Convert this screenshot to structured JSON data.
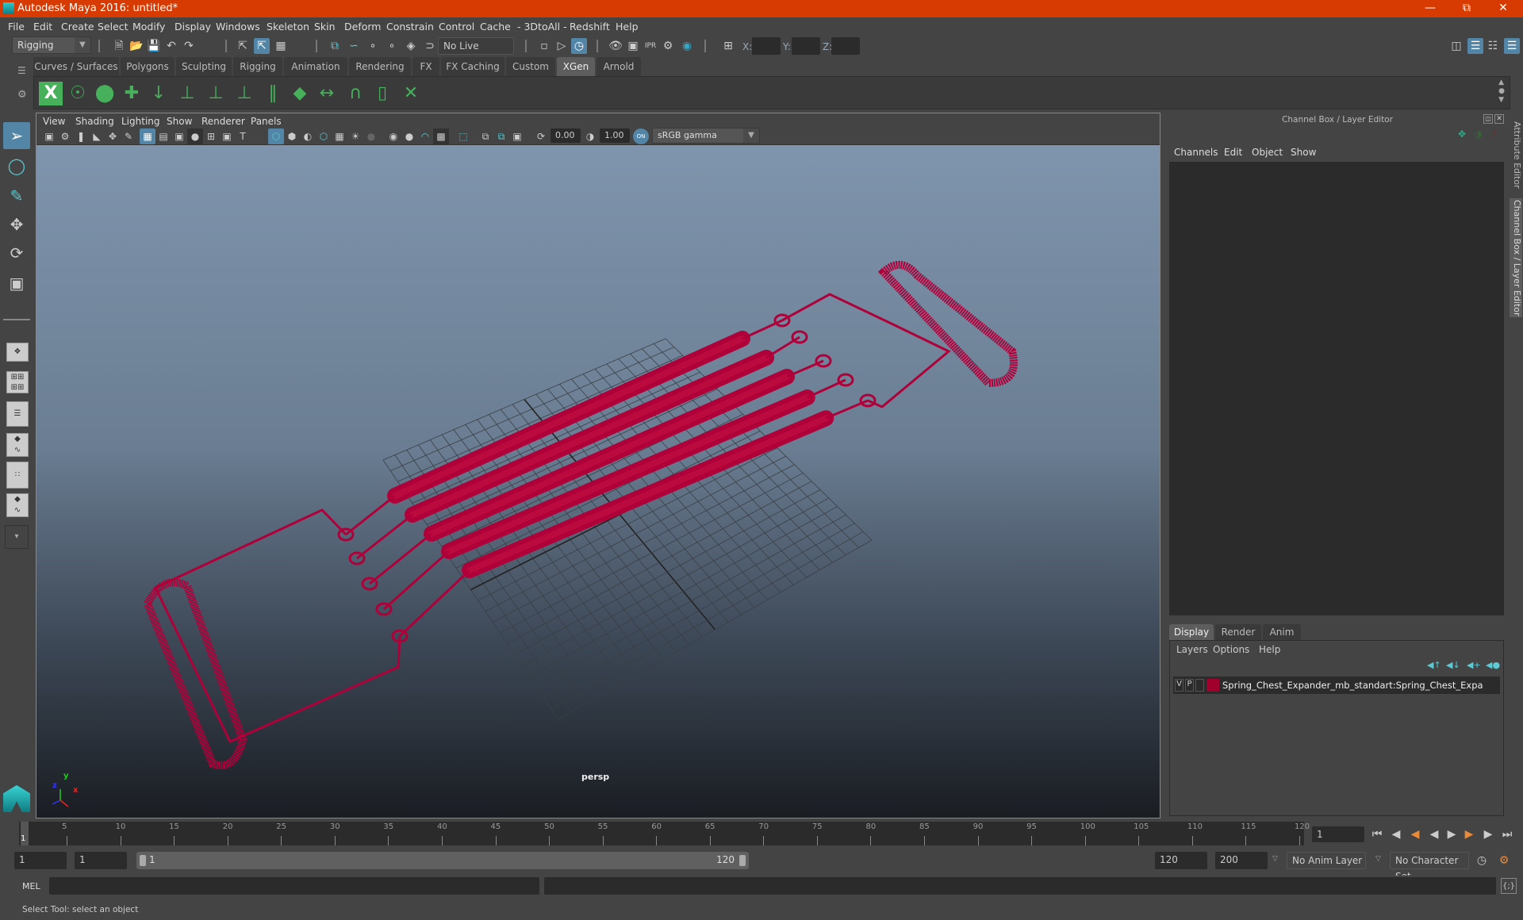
{
  "window": {
    "title": "Autodesk Maya 2016: untitled*",
    "controls": [
      "minimize",
      "restore",
      "close"
    ]
  },
  "menubar": [
    "File",
    "Edit",
    "Create",
    "Select",
    "Modify",
    "Display",
    "Windows",
    "Skeleton",
    "Skin",
    "Deform",
    "Constrain",
    "Control",
    "Cache",
    "- 3DtoAll -",
    "Redshift",
    "Help"
  ],
  "statusline": {
    "menuset": "Rigging",
    "live_surface": "No Live Surface",
    "x_label": "X:",
    "y_label": "Y:",
    "z_label": "Z:",
    "x_value": "",
    "y_value": "",
    "z_value": ""
  },
  "shelf": {
    "tabs": [
      "Curves / Surfaces",
      "Polygons",
      "Sculpting",
      "Rigging",
      "Animation",
      "Rendering",
      "FX",
      "FX Caching",
      "Custom",
      "XGen",
      "Arnold"
    ],
    "active_tab": "XGen",
    "icons": [
      "xgen-editor-icon",
      "xgen-preview-icon",
      "xgen-clear-preview-icon",
      "add-guide-icon",
      "sculpt-guide-icon",
      "add-guide-tool-icon",
      "guide-visibility-icon",
      "lock-guide-icon",
      "guide-split-icon",
      "density-map-icon",
      "bind-guide-icon",
      "select-guide-icon",
      "guide-bounds-icon",
      "delete-guide-icon"
    ]
  },
  "toolbox": [
    "select-tool",
    "lasso-tool",
    "paint-select-tool",
    "move-tool",
    "rotate-tool",
    "scale-tool"
  ],
  "viewport": {
    "menu": [
      "View",
      "Shading",
      "Lighting",
      "Show",
      "Renderer",
      "Panels"
    ],
    "exposure": "0.00",
    "gamma": "1.00",
    "color_mgmt": "ON",
    "color_space": "sRGB gamma",
    "camera_label": "persp",
    "axis": {
      "x": "x",
      "y": "y",
      "z": "z"
    },
    "wire_color": "#b0003a"
  },
  "channel_box": {
    "title": "Channel Box / Layer Editor",
    "menu": [
      "Channels",
      "Edit",
      "Object",
      "Show"
    ]
  },
  "layer_editor": {
    "tabs": [
      "Display",
      "Render",
      "Anim"
    ],
    "active_tab": "Display",
    "menu": [
      "Layers",
      "Options",
      "Help"
    ],
    "layers": [
      {
        "v": "V",
        "p": "P",
        "color": "#a0002c",
        "name": "Spring_Chest_Expander_mb_standart:Spring_Chest_Expa"
      }
    ]
  },
  "side_tabs": [
    "Attribute Editor",
    "Channel Box / Layer Editor"
  ],
  "timeline": {
    "ticks": [
      1,
      5,
      10,
      15,
      20,
      25,
      30,
      35,
      40,
      45,
      50,
      55,
      60,
      65,
      70,
      75,
      80,
      85,
      90,
      95,
      100,
      105,
      110,
      115,
      120
    ],
    "current_frame": "1",
    "current_frame_field": "1"
  },
  "range": {
    "start": "1",
    "playback_start": "1",
    "slider_start": "1",
    "slider_end": "120",
    "playback_end": "120",
    "end": "200",
    "anim_layer": "No Anim Layer",
    "character_set": "No Character Set"
  },
  "command": {
    "label": "MEL",
    "value": ""
  },
  "help_line": "Select Tool: select an object"
}
